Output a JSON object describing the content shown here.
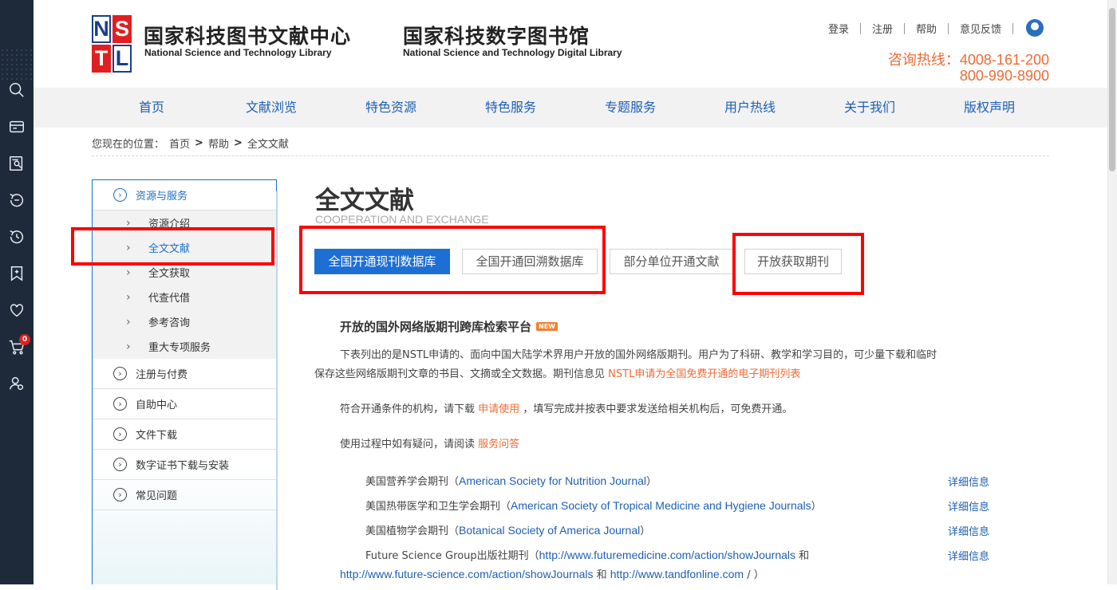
{
  "toolbar": {
    "icons": [
      "search-icon",
      "newspaper-icon",
      "document-search-icon",
      "history-sync-icon",
      "history-icon",
      "bookmark-add-icon",
      "heart-icon",
      "cart-icon",
      "user-settings-icon"
    ],
    "cart_count": "0"
  },
  "header": {
    "logo_letters": [
      "N",
      "S",
      "T",
      "L"
    ],
    "title_cn": "国家科技图书文献中心",
    "title_en": "National Science and Technology Library",
    "title2_cn": "国家科技数字图书馆",
    "title2_en": "National Science and Technology Digital Library",
    "links": [
      "登录",
      "注册",
      "帮助",
      "意见反馈"
    ],
    "hotline_label": "咨询热线：4008-161-200",
    "hotline_2": "800-990-8900"
  },
  "nav": [
    "首页",
    "文献浏览",
    "特色资源",
    "特色服务",
    "专题服务",
    "用户热线",
    "关于我们",
    "版权声明"
  ],
  "breadcrumb": {
    "prefix": "您现在的位置：",
    "items": [
      "首页",
      "帮助",
      "全文文献"
    ],
    "separator": ">"
  },
  "sidebar": {
    "sections": [
      {
        "label": "资源与服务",
        "active": true
      },
      {
        "label": "注册与付费"
      },
      {
        "label": "自助中心"
      },
      {
        "label": "文件下载"
      },
      {
        "label": "数字证书下载与安装"
      },
      {
        "label": "常见问题"
      }
    ],
    "sub_items": [
      "资源介绍",
      "全文文献",
      "全文获取",
      "代查代借",
      "参考咨询",
      "重大专项服务"
    ],
    "active_sub": "全文文献"
  },
  "main": {
    "title": "全文文献",
    "subtitle_en": "COOPERATION AND EXCHANGE",
    "tabs": [
      "全国开通现刊数据库",
      "全国开通回溯数据库",
      "部分单位开通文献",
      "开放获取期刊"
    ],
    "active_tab": "全国开通现刊数据库",
    "content_title": "开放的国外网络版期刊跨库检索平台",
    "new_badge": "NEW",
    "para1_a": "下表列出的是NSTL申请的、面向中国大陆学术界用户开放的国外网络版期刊。用户为了科研、教学和学习目的，可少量下载和临时",
    "para1_b": "保存这些网络版期刊文章的书目、文摘或全文数据。期刊信息见",
    "para1_link": "NSTL申请为全国免费开通的电子期刊列表",
    "para2_a": "符合开通条件的机构，请下载",
    "para2_link": "申请使用",
    "para2_b": "，填写完成并按表中要求发送给相关机构后，可免费开通。",
    "para3_a": "使用过程中如有疑问，请阅读",
    "para3_link": "服务问答",
    "journals": [
      {
        "cn": "美国营养学会期刊（",
        "en": "American Society for Nutrition Journal",
        "close": "）",
        "detail": "详细信息"
      },
      {
        "cn": "美国热带医学和卫生学会期刊（",
        "en": "American Society of Tropical Medicine and Hygiene Journals",
        "close": "）",
        "detail": "详细信息"
      },
      {
        "cn": "美国植物学会期刊（",
        "en": "Botanical Society of America Journal",
        "close": "）",
        "detail": "详细信息"
      },
      {
        "cn": "Future Science Group出版社期刊（",
        "en": "http://www.futuremedicine.com/action/showJournals",
        "close": " 和",
        "detail": "详细信息",
        "line2_a": "http://www.future-science.com/action/showJournals",
        "line2_and": " 和 ",
        "line2_b": "http://www.tandfonline.com",
        "line2_close": " / ）"
      }
    ]
  }
}
